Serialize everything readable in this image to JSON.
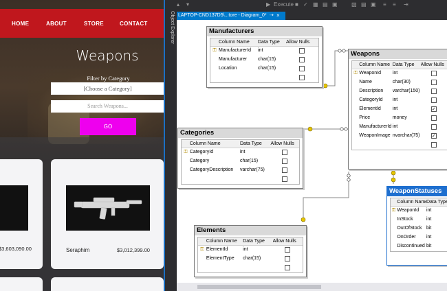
{
  "website": {
    "nav": {
      "home": "HOME",
      "about": "ABOUT",
      "store": "STORE",
      "contact": "CONTACT"
    },
    "page_title": "Weapons",
    "filter_label": "Filter by Category",
    "category_select": {
      "value": "[Choose a Category]"
    },
    "search": {
      "placeholder": "Search Weapons..."
    },
    "go_label": "GO",
    "cards": [
      {
        "name": "",
        "price": "$3,603,090.00"
      },
      {
        "name": "Seraphim",
        "price": "$3,012,399.00"
      }
    ]
  },
  "object_explorer": {
    "label": "Object Explorer"
  },
  "tab": {
    "title": "LAPTOP-CND137D5\\...tore - Diagram_0*",
    "pin": "⇢",
    "close": "×"
  },
  "toolbar": {
    "execute_label": "Execute"
  },
  "diagram": {
    "column_headers": {
      "name": "Column Name",
      "type": "Data Type",
      "nulls": "Allow Nulls"
    },
    "tables": {
      "manufacturers": {
        "title": "Manufacturers",
        "rows": [
          {
            "key": true,
            "name": "ManufacturerId",
            "type": "int",
            "nulls": false
          },
          {
            "key": false,
            "name": "Manufacturer",
            "type": "char(15)",
            "nulls": false
          },
          {
            "key": false,
            "name": "Location",
            "type": "char(15)",
            "nulls": false
          },
          {
            "key": false,
            "name": "",
            "type": "",
            "nulls": false
          }
        ]
      },
      "weapons": {
        "title": "Weapons",
        "rows": [
          {
            "key": true,
            "name": "WeaponId",
            "type": "int",
            "nulls": false
          },
          {
            "key": false,
            "name": "Name",
            "type": "char(30)",
            "nulls": false
          },
          {
            "key": false,
            "name": "Description",
            "type": "varchar(150)",
            "nulls": false
          },
          {
            "key": false,
            "name": "CategoryId",
            "type": "int",
            "nulls": false
          },
          {
            "key": false,
            "name": "ElementId",
            "type": "int",
            "nulls": true
          },
          {
            "key": false,
            "name": "Price",
            "type": "money",
            "nulls": false
          },
          {
            "key": false,
            "name": "ManufacturerId",
            "type": "int",
            "nulls": false
          },
          {
            "key": false,
            "name": "WeaponImage",
            "type": "nvarchar(75)",
            "nulls": true
          },
          {
            "key": false,
            "name": "",
            "type": "",
            "nulls": false
          }
        ]
      },
      "categories": {
        "title": "Categories",
        "rows": [
          {
            "key": true,
            "name": "CategoryId",
            "type": "int",
            "nulls": false
          },
          {
            "key": false,
            "name": "Category",
            "type": "char(15)",
            "nulls": false
          },
          {
            "key": false,
            "name": "CategoryDescription",
            "type": "varchar(75)",
            "nulls": false
          },
          {
            "key": false,
            "name": "",
            "type": "",
            "nulls": false
          }
        ]
      },
      "elements": {
        "title": "Elements",
        "rows": [
          {
            "key": true,
            "name": "ElementId",
            "type": "int",
            "nulls": false
          },
          {
            "key": false,
            "name": "ElementType",
            "type": "char(15)",
            "nulls": false
          },
          {
            "key": false,
            "name": "",
            "type": "",
            "nulls": false
          }
        ]
      },
      "weaponstatuses": {
        "title": "WeaponStatuses",
        "rows": [
          {
            "key": true,
            "name": "WeaponId",
            "type": "int",
            "nulls": null
          },
          {
            "key": false,
            "name": "InStock",
            "type": "int",
            "nulls": null
          },
          {
            "key": false,
            "name": "OutOfStock",
            "type": "bit",
            "nulls": null
          },
          {
            "key": false,
            "name": "OnOrder",
            "type": "int",
            "nulls": null
          },
          {
            "key": false,
            "name": "Discontinued",
            "type": "bit",
            "nulls": null
          }
        ]
      }
    }
  },
  "colors": {
    "nav_red": "#c0171d",
    "go_magenta": "#ee00ee",
    "selection_blue": "#1e6fcf",
    "tab_blue": "#007acc"
  }
}
